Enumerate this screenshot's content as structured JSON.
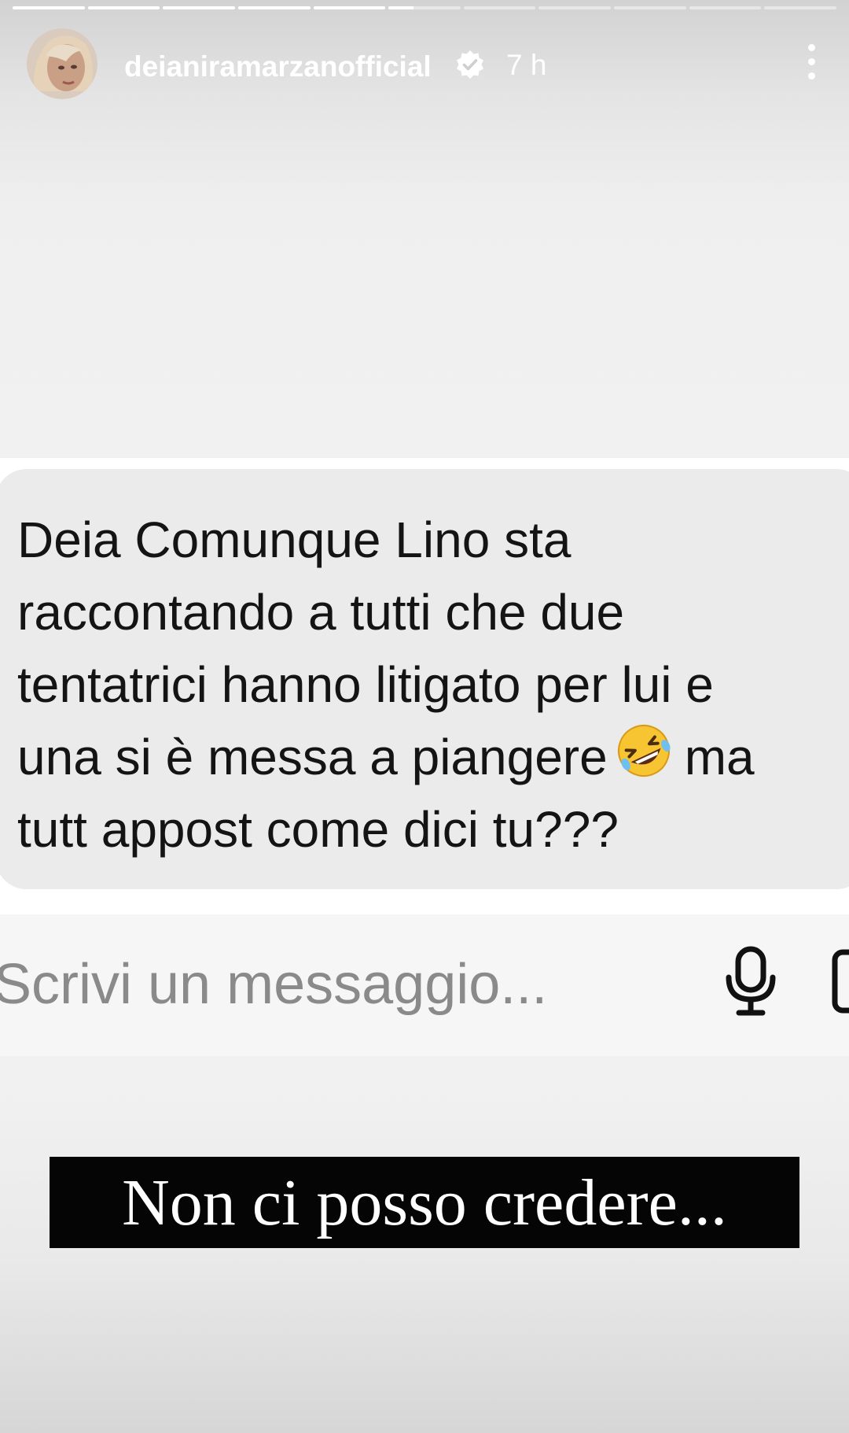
{
  "story": {
    "segments_total": 11,
    "segments_completed": 5,
    "current_segment_progress": 0.35,
    "username": "deianiramarzanofficial",
    "timestamp": "7 h",
    "verified": true
  },
  "message": {
    "lines": [
      "Deia Comunque Lino sta",
      "raccontando a tutti che due",
      "tentatrici hanno litigato per lui e",
      "una si è messa a piangere",
      "tutt appost come dici tu???"
    ],
    "line4_after_emoji": "ma",
    "emoji": "rolling-on-floor-laughing-emoji"
  },
  "composer": {
    "placeholder": "Scrivi un messaggio..."
  },
  "caption": {
    "text": "Non ci posso credere..."
  },
  "colors": {
    "caption_bg": "#050505",
    "bubble_bg": "#ebebeb",
    "placeholder": "#8a8a8a"
  }
}
